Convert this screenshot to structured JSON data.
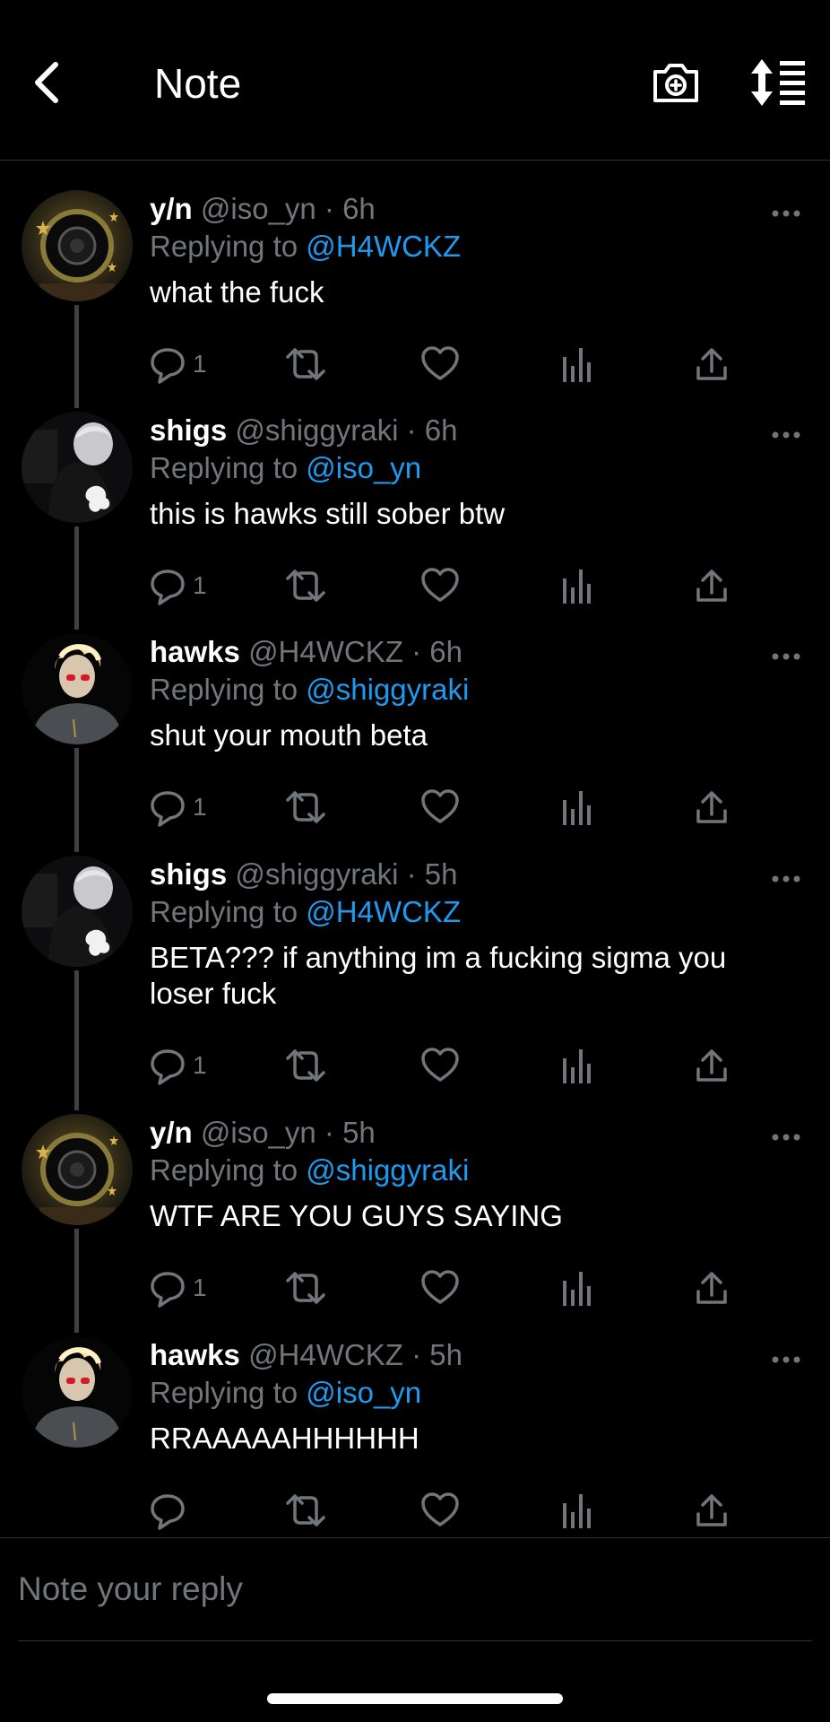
{
  "header": {
    "title": "Note"
  },
  "thread": [
    {
      "name": "y/n",
      "handle": "@iso_yn",
      "time": "6h",
      "replying_prefix": "Replying to ",
      "replying_to": "@H4WCKZ",
      "text": "what the fuck",
      "reply_count": "1",
      "avatar": "camera"
    },
    {
      "name": "shigs",
      "handle": "@shiggyraki",
      "time": "6h",
      "replying_prefix": "Replying to ",
      "replying_to": "@iso_yn",
      "text": "this is hawks still sober btw",
      "reply_count": "1",
      "avatar": "silver"
    },
    {
      "name": "hawks",
      "handle": "@H4WCKZ",
      "time": "6h",
      "replying_prefix": "Replying to ",
      "replying_to": "@shiggyraki",
      "text": "shut your mouth beta",
      "reply_count": "1",
      "avatar": "blonde"
    },
    {
      "name": "shigs",
      "handle": "@shiggyraki",
      "time": "5h",
      "replying_prefix": "Replying to ",
      "replying_to": "@H4WCKZ",
      "text": "BETA??? if anything im a fucking sigma you loser fuck",
      "reply_count": "1",
      "avatar": "silver"
    },
    {
      "name": "y/n",
      "handle": "@iso_yn",
      "time": "5h",
      "replying_prefix": "Replying to ",
      "replying_to": "@shiggyraki",
      "text": "WTF ARE YOU GUYS SAYING",
      "reply_count": "1",
      "avatar": "camera"
    },
    {
      "name": "hawks",
      "handle": "@H4WCKZ",
      "time": "5h",
      "replying_prefix": "Replying to ",
      "replying_to": "@iso_yn",
      "text": "RRAAAAAHHHHHH",
      "reply_count": "",
      "avatar": "blonde"
    }
  ],
  "composer": {
    "placeholder": "Note your reply"
  },
  "colors": {
    "background": "#000000",
    "accent": "#1d9bf0",
    "muted": "#71767b",
    "divider": "#2f3336"
  },
  "icons": {
    "header": [
      "back-arrow-icon",
      "camera-plus-icon",
      "sort-icon"
    ],
    "actions": [
      "reply-icon",
      "retweet-icon",
      "like-icon",
      "views-icon",
      "share-icon"
    ],
    "more": "more-dots-icon"
  }
}
